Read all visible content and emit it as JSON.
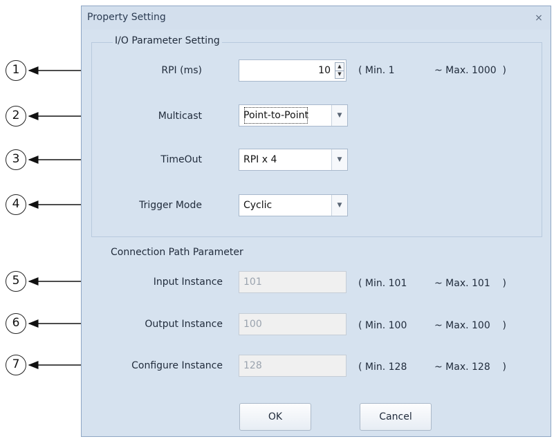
{
  "dialog": {
    "title": "Property Setting",
    "close_icon": "close-icon"
  },
  "io_section": {
    "title": "I/O Parameter Setting",
    "rpi": {
      "label": "RPI (ms)",
      "value": "10",
      "range_min": "( Min. 1",
      "range_max": "~ Max. 1000  )"
    },
    "multicast": {
      "label": "Multicast",
      "value": "Point-to-Point"
    },
    "timeout": {
      "label": "TimeOut",
      "value": "RPI x 4"
    },
    "trigger": {
      "label": "Trigger Mode",
      "value": "Cyclic"
    }
  },
  "path_section": {
    "title": "Connection Path Parameter",
    "input": {
      "label": "Input Instance",
      "value": "101",
      "range_min": "( Min. 101",
      "range_max": "~ Max. 101    )"
    },
    "output": {
      "label": "Output Instance",
      "value": "100",
      "range_min": "( Min. 100",
      "range_max": "~ Max. 100    )"
    },
    "configure": {
      "label": "Configure Instance",
      "value": "128",
      "range_min": "( Min. 128",
      "range_max": "~ Max. 128    )"
    }
  },
  "buttons": {
    "ok": "OK",
    "cancel": "Cancel"
  },
  "callouts": [
    "1",
    "2",
    "3",
    "4",
    "5",
    "6",
    "7"
  ],
  "colors": {
    "dialog_bg": "#d6e2ef",
    "border": "#8ea6c4"
  }
}
